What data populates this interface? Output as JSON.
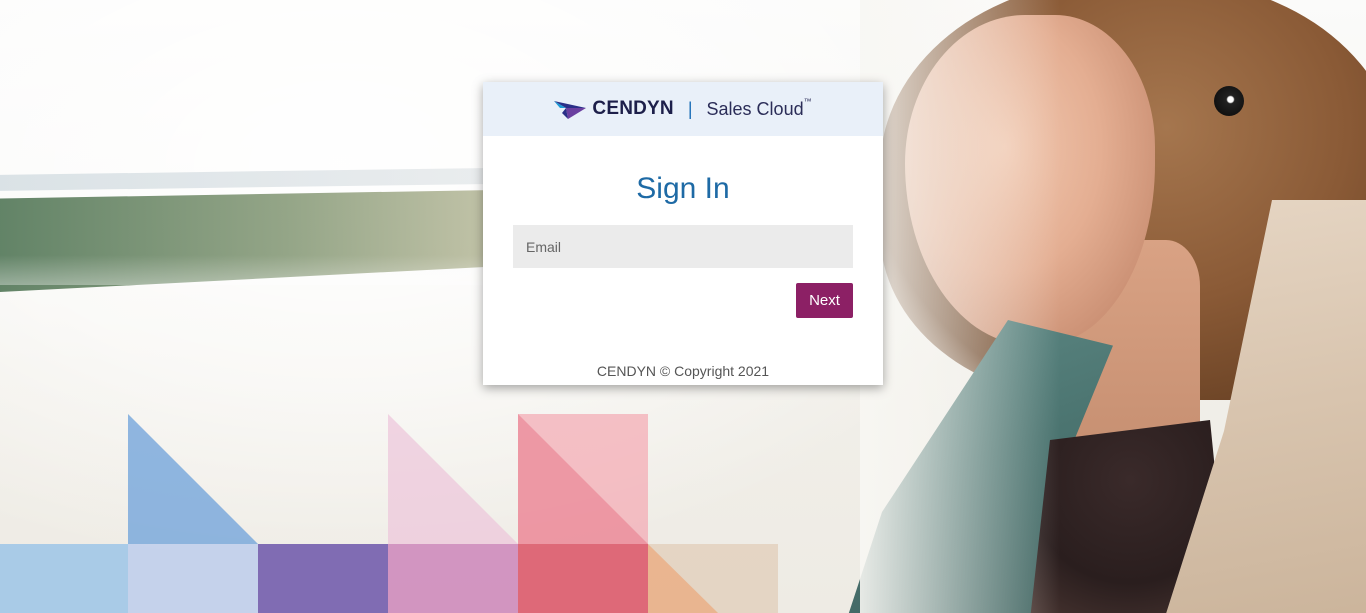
{
  "brand": {
    "company": "CENDYN",
    "product": "Sales Cloud",
    "trademark": "™",
    "separator": "|",
    "colors": {
      "navy": "#1d1f4a",
      "blue": "#1e6aa5",
      "accent_button": "#8c2065",
      "header_bg": "#e9f0f9"
    }
  },
  "signin": {
    "title": "Sign In",
    "email_placeholder": "Email",
    "email_value": "",
    "next_label": "Next"
  },
  "footer": {
    "copyright": "CENDYN © Copyright 2021"
  },
  "icons": {
    "logo_mark": "cendyn-arrow-logo-icon"
  }
}
